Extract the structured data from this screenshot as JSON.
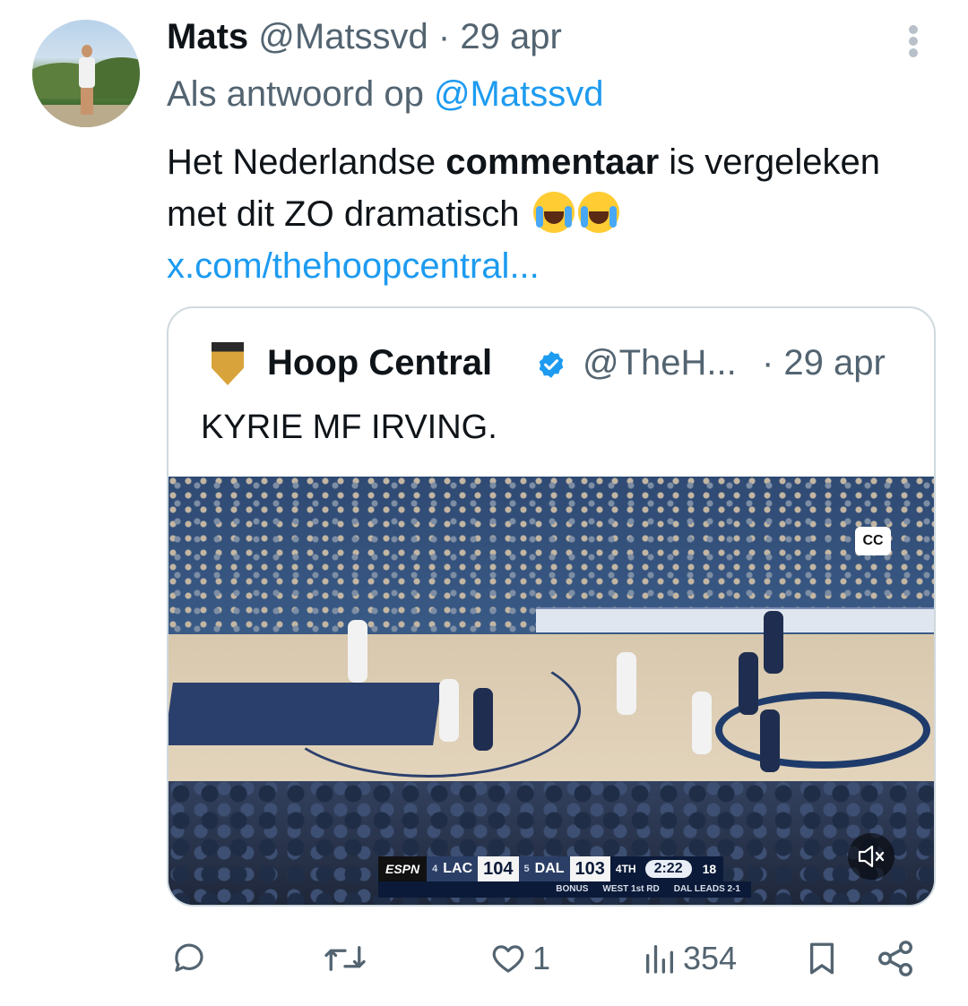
{
  "tweet": {
    "author_name": "Mats",
    "author_handle": "@Matssvd",
    "separator": "·",
    "date": "29 apr",
    "reply_prefix": "Als antwoord op ",
    "reply_mention": "@Matssvd",
    "text_part1": "Het Nederlandse ",
    "text_bold": "commentaar",
    "text_part2": " is vergeleken met dit ZO dramatisch",
    "emoji": [
      "loudly-crying-face-emoji",
      "loudly-crying-face-emoji"
    ],
    "link": "x.com/thehoopcentral..."
  },
  "quote": {
    "author_name": "Hoop Central",
    "author_handle": "@TheH...",
    "date": "· 29 apr",
    "text": "KYRIE MF IRVING.",
    "video": {
      "cc_label": "CC",
      "scoreboard": {
        "network": "ESPN",
        "away_seed": "4",
        "away_team": "LAC",
        "away_score": "104",
        "home_seed": "5",
        "home_team": "DAL",
        "home_score": "103",
        "quarter": "4TH",
        "clock": "2:22",
        "shot_clock": "18",
        "sub_bonus": "BONUS",
        "sub_round": "WEST 1st RD",
        "sub_series": "DAL LEADS 2-1"
      }
    }
  },
  "actions": {
    "reply_count": "",
    "repost_count": "",
    "like_count": "1",
    "views_count": "354"
  },
  "colors": {
    "text": "#0f1419",
    "secondary": "#536471",
    "link": "#1d9bf0",
    "border": "#cfd9de"
  }
}
